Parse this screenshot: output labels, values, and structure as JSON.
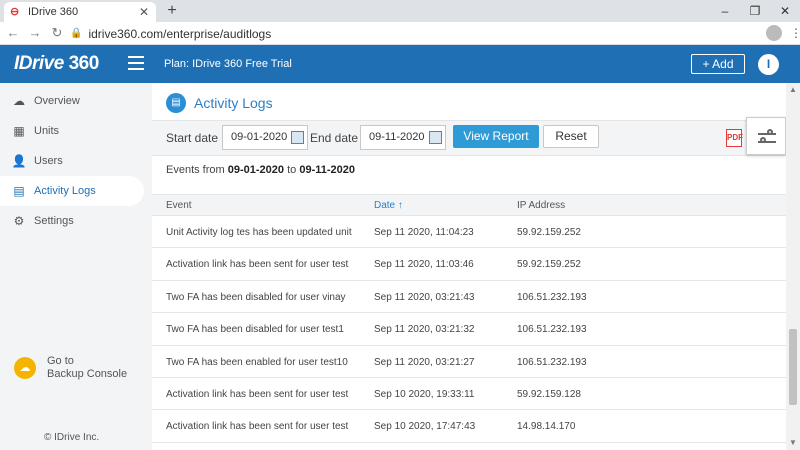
{
  "browser": {
    "tab_title": "IDrive 360",
    "url": "idrive360.com/enterprise/auditlogs"
  },
  "header": {
    "logo_text": "IDrive",
    "logo_num": "360",
    "plan": "Plan: IDrive 360 Free Trial",
    "add_label": "+ Add",
    "avatar_initial": "I"
  },
  "sidebar": {
    "items": [
      {
        "label": "Overview",
        "icon": "cloud-icon"
      },
      {
        "label": "Units",
        "icon": "units-icon"
      },
      {
        "label": "Users",
        "icon": "user-icon"
      },
      {
        "label": "Activity Logs",
        "icon": "clipboard-icon"
      },
      {
        "label": "Settings",
        "icon": "gear-icon"
      }
    ],
    "active": "Activity Logs",
    "backup_line1": "Go to",
    "backup_line2": "Backup Console",
    "copyright": "© IDrive Inc."
  },
  "main": {
    "title": "Activity Logs",
    "start_label": "Start date",
    "start_value": "09-01-2020",
    "end_label": "End date",
    "end_value": "09-11-2020",
    "view_report": "View Report",
    "reset": "Reset",
    "pdf_label": "PDF",
    "summary_prefix": "Events from ",
    "summary_from": "09-01-2020",
    "summary_mid": " to ",
    "summary_to": "09-11-2020"
  },
  "table": {
    "columns": {
      "event": "Event",
      "date": "Date ↑",
      "ip": "IP Address"
    },
    "rows": [
      {
        "event": "Unit Activity log tes has been updated unit",
        "date": "Sep 11 2020, 11:04:23",
        "ip": "59.92.159.252"
      },
      {
        "event": "Activation link has been sent for user test",
        "date": "Sep 11 2020, 11:03:46",
        "ip": "59.92.159.252"
      },
      {
        "event": "Two FA has been disabled for user vinay",
        "date": "Sep 11 2020, 03:21:43",
        "ip": "106.51.232.193"
      },
      {
        "event": "Two FA has been disabled for user test1",
        "date": "Sep 11 2020, 03:21:32",
        "ip": "106.51.232.193"
      },
      {
        "event": "Two FA has been enabled for user test10",
        "date": "Sep 11 2020, 03:21:27",
        "ip": "106.51.232.193"
      },
      {
        "event": "Activation link has been sent for user test",
        "date": "Sep 10 2020, 19:33:11",
        "ip": "59.92.159.128"
      },
      {
        "event": "Activation link has been sent for user test",
        "date": "Sep 10 2020, 17:47:43",
        "ip": "14.98.14.170"
      }
    ]
  }
}
